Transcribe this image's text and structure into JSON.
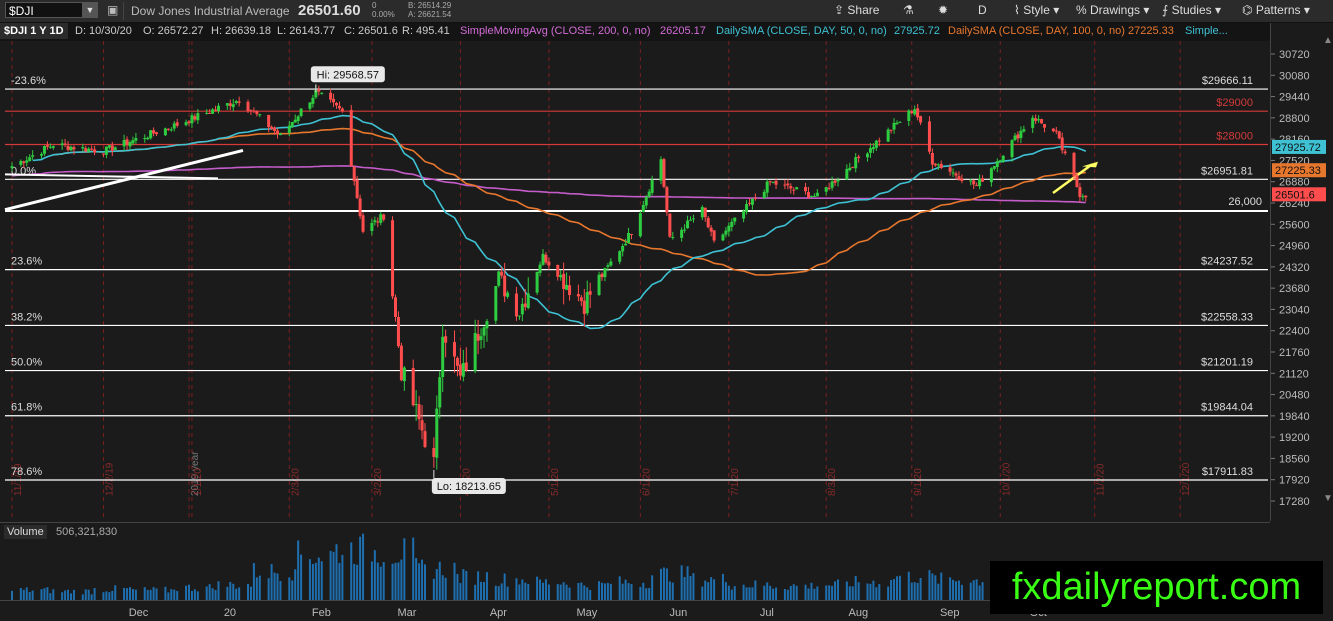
{
  "toolbar": {
    "symbol": "$DJI",
    "description": "Dow Jones Industrial Average",
    "last": "26501.60",
    "net_change": "0",
    "pct_change": "0.00%",
    "bid": "B: 26514.29",
    "ask": "A: 26621.54",
    "share_label": "Share",
    "timeframe_label": "D",
    "style_label": "Style",
    "drawings_label": "Drawings",
    "studies_label": "Studies",
    "patterns_label": "Patterns"
  },
  "studybar": {
    "symbol_period": "$DJI 1 Y 1D",
    "date": "D: 10/30/20",
    "open": "O: 26572.27",
    "high": "H: 26639.18",
    "low": "L: 26143.77",
    "close": "C: 26501.6",
    "range": "R: 495.41",
    "sma200_label": "SimpleMovingAvg (CLOSE, 200, 0, no)",
    "sma200_value": "26205.17",
    "sma50_label": "DailySMA (CLOSE, DAY, 50, 0, no)",
    "sma50_value": "27925.72",
    "sma100_label": "DailySMA (CLOSE, DAY, 100, 0, no)",
    "sma100_value": "27225.33",
    "more_label": "Simple..."
  },
  "colors": {
    "up": "#2ecc40",
    "down": "#ff4d4d",
    "sma50": "#3ec1d3",
    "sma100": "#e8772e",
    "sma200": "#c45cc9",
    "fib": "#ffffff",
    "resistance": "#d43a3a",
    "arrow": "#ffff66"
  },
  "chart_data": {
    "type": "candlestick",
    "ylim": [
      17000,
      30900
    ],
    "y_ticks": [
      30720,
      30080,
      29440,
      28800,
      28160,
      27520,
      26880,
      26240,
      25600,
      24960,
      24320,
      23680,
      23040,
      22400,
      21760,
      21120,
      20480,
      19840,
      19200,
      18560,
      17920,
      17280
    ],
    "price_badges": [
      {
        "label": "27925.72",
        "value": 27925.72,
        "color": "#3ec1d3"
      },
      {
        "label": "27225.33",
        "value": 27225.33,
        "color": "#e8772e"
      },
      {
        "label": "26501.6",
        "value": 26501.6,
        "color": "#ff4d4d"
      }
    ],
    "fib_levels": [
      {
        "pct": "-23.6%",
        "price": "$29666.11",
        "value": 29666.11
      },
      {
        "pct": "0.0%",
        "price": "$26951.81",
        "value": 26951.81
      },
      {
        "pct": "23.6%",
        "price": "$24237.52",
        "value": 24237.52
      },
      {
        "pct": "38.2%",
        "price": "$22558.33",
        "value": 22558.33
      },
      {
        "pct": "50.0%",
        "price": "$21201.19",
        "value": 21201.19
      },
      {
        "pct": "61.8%",
        "price": "$19844.04",
        "value": 19844.04
      },
      {
        "pct": "78.6%",
        "price": "$17911.83",
        "value": 17911.83
      }
    ],
    "resistance_levels": [
      {
        "label": "$29000",
        "value": 29000
      },
      {
        "label": "$28000",
        "value": 28000
      }
    ],
    "support_level": {
      "label": "26,000",
      "value": 26000
    },
    "high_annotation": "Hi: 29568.57",
    "low_annotation": "Lo: 18213.65",
    "month_labels": [
      "Dec",
      "20",
      "Feb",
      "Mar",
      "Apr",
      "May",
      "Jun",
      "Jul",
      "Aug",
      "Sep",
      "Oct"
    ],
    "x_start": "2019-11-01",
    "date_markers": [
      "11/1/19",
      "12/2/19",
      "2019 year",
      "1/1/20",
      "2/3/20",
      "3/2/20",
      "4/1/20",
      "5/1/20",
      "6/1/20",
      "7/1/20",
      "8/3/20",
      "9/1/20",
      "10/1/20",
      "11/2/20",
      "12/1/20",
      "2020 year",
      "1/1/21"
    ],
    "anchors": [
      [
        "2019-11-01",
        27350
      ],
      [
        "2019-11-15",
        28000
      ],
      [
        "2019-12-02",
        27800
      ],
      [
        "2019-12-27",
        28600
      ],
      [
        "2020-01-17",
        29350
      ],
      [
        "2020-01-31",
        28250
      ],
      [
        "2020-02-12",
        29568
      ],
      [
        "2020-02-21",
        28990
      ],
      [
        "2020-02-28",
        25400
      ],
      [
        "2020-03-06",
        25860
      ],
      [
        "2020-03-12",
        21200
      ],
      [
        "2020-03-16",
        20190
      ],
      [
        "2020-03-23",
        18400
      ],
      [
        "2020-03-26",
        22550
      ],
      [
        "2020-04-01",
        20940
      ],
      [
        "2020-04-14",
        23950
      ],
      [
        "2020-04-21",
        23010
      ],
      [
        "2020-04-29",
        24640
      ],
      [
        "2020-05-13",
        23250
      ],
      [
        "2020-05-29",
        25380
      ],
      [
        "2020-06-08",
        27570
      ],
      [
        "2020-06-11",
        25130
      ],
      [
        "2020-06-22",
        26020
      ],
      [
        "2020-06-26",
        25020
      ],
      [
        "2020-07-15",
        26870
      ],
      [
        "2020-07-31",
        26430
      ],
      [
        "2020-08-17",
        27840
      ],
      [
        "2020-09-02",
        29100
      ],
      [
        "2020-09-08",
        27500
      ],
      [
        "2020-09-23",
        26760
      ],
      [
        "2020-10-12",
        28840
      ],
      [
        "2020-10-20",
        28300
      ],
      [
        "2020-10-28",
        26520
      ],
      [
        "2020-10-30",
        26501
      ]
    ]
  },
  "volume": {
    "label": "Volume",
    "value": "506,321,830",
    "levels": [
      0.2,
      0.18,
      0.22,
      0.2,
      0.25,
      0.3,
      0.55,
      0.85,
      0.95,
      0.9,
      0.6,
      0.45,
      0.4,
      0.35,
      0.3,
      0.35,
      0.5,
      0.4,
      0.3,
      0.28,
      0.3,
      0.35,
      0.45,
      0.4,
      0.38,
      0.4,
      0.32
    ]
  },
  "brand": "fxdailyreport.com"
}
